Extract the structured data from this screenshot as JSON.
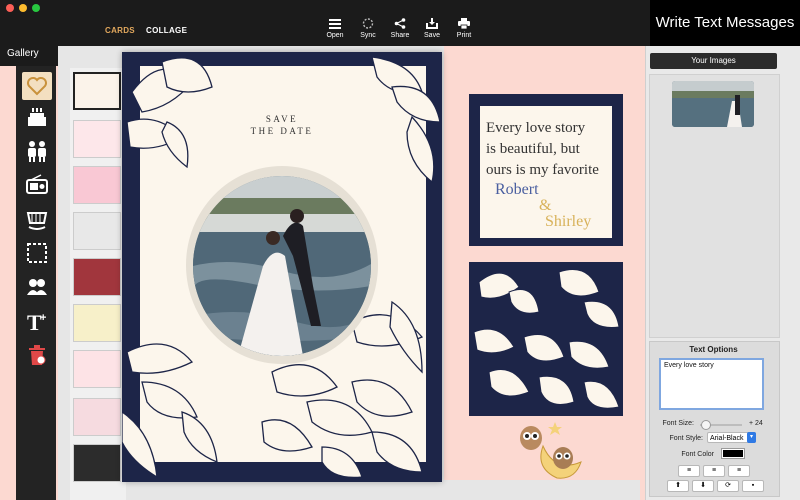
{
  "toolbar": {
    "tabs": [
      {
        "label": "CARDS",
        "active": true
      },
      {
        "label": "COLLAGE",
        "active": false
      }
    ],
    "tools": [
      {
        "label": "Open",
        "icon": "menu-lines-icon"
      },
      {
        "label": "Sync",
        "icon": "sync-spinner-icon"
      },
      {
        "label": "Share",
        "icon": "share-icon"
      },
      {
        "label": "Save",
        "icon": "save-tray-icon"
      },
      {
        "label": "Print",
        "icon": "printer-icon"
      }
    ]
  },
  "promo_banner": "Write Text Messages",
  "sidebar": {
    "title": "Gallery",
    "categories": [
      {
        "icon": "heart-icon"
      },
      {
        "icon": "cake-icon"
      },
      {
        "icon": "family-icon"
      },
      {
        "icon": "radio-icon"
      },
      {
        "icon": "cradle-icon"
      },
      {
        "icon": "frame-icon"
      },
      {
        "icon": "friends-icon"
      },
      {
        "icon": "add-text-icon"
      },
      {
        "icon": "trash-icon"
      }
    ]
  },
  "card": {
    "save_line1": "SAVE",
    "save_line2": "THE DATE"
  },
  "message_card": {
    "lines": [
      "Every love story",
      "is beautiful, but",
      "ours is my favorite"
    ],
    "name1": "Robert",
    "amp": "&",
    "name2": "Shirley",
    "name1_color": "#4a5fa0",
    "name2_color": "#d8b25a"
  },
  "right_panel": {
    "images_button": "Your Images",
    "text_options_title": "Text Options",
    "text_value": "Every love story",
    "font_size_label": "Font Size:",
    "font_size_max": "+ 24",
    "font_size_level": 0.12,
    "font_style_label": "Font Style:",
    "font_style_value": "Arial-Black",
    "font_color_label": "Font Color",
    "font_color_value": "#000000"
  },
  "colors": {
    "accent_tab": "#e2a85d",
    "navy": "#1d2548",
    "cream": "#fcf6ec",
    "pink_bg": "#fcd9d1"
  }
}
